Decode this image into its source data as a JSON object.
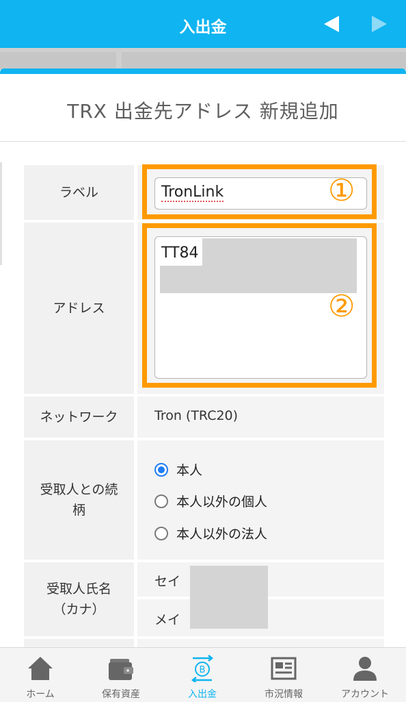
{
  "header_bar": {
    "title": "入出金"
  },
  "page": {
    "title": "TRX 出金先アドレス 新規追加"
  },
  "form": {
    "label": {
      "label": "ラベル",
      "value": "TronLink",
      "marker": "①"
    },
    "address": {
      "label": "アドレス",
      "value": "TT84",
      "marker": "②"
    },
    "network": {
      "label": "ネットワーク",
      "value": "Tron (TRC20)"
    },
    "relationship": {
      "label_line1": "受取人との続",
      "label_line2": "柄",
      "options": [
        "本人",
        "本人以外の個人",
        "本人以外の法人"
      ],
      "selected": "本人"
    },
    "recipient_name": {
      "label_line1": "受取人氏名",
      "label_line2": "（カナ）",
      "sei": "セイ",
      "mei": "メイ"
    }
  },
  "tabs": [
    {
      "label": "ホーム",
      "icon": "home-icon"
    },
    {
      "label": "保有資産",
      "icon": "wallet-icon"
    },
    {
      "label": "入出金",
      "icon": "transfer-icon",
      "active": true
    },
    {
      "label": "市況情報",
      "icon": "news-icon"
    },
    {
      "label": "アカウント",
      "icon": "account-icon"
    }
  ],
  "colors": {
    "accent": "#0fb4f0",
    "highlight": "#ff9a00",
    "radio": "#1e7cf5"
  }
}
